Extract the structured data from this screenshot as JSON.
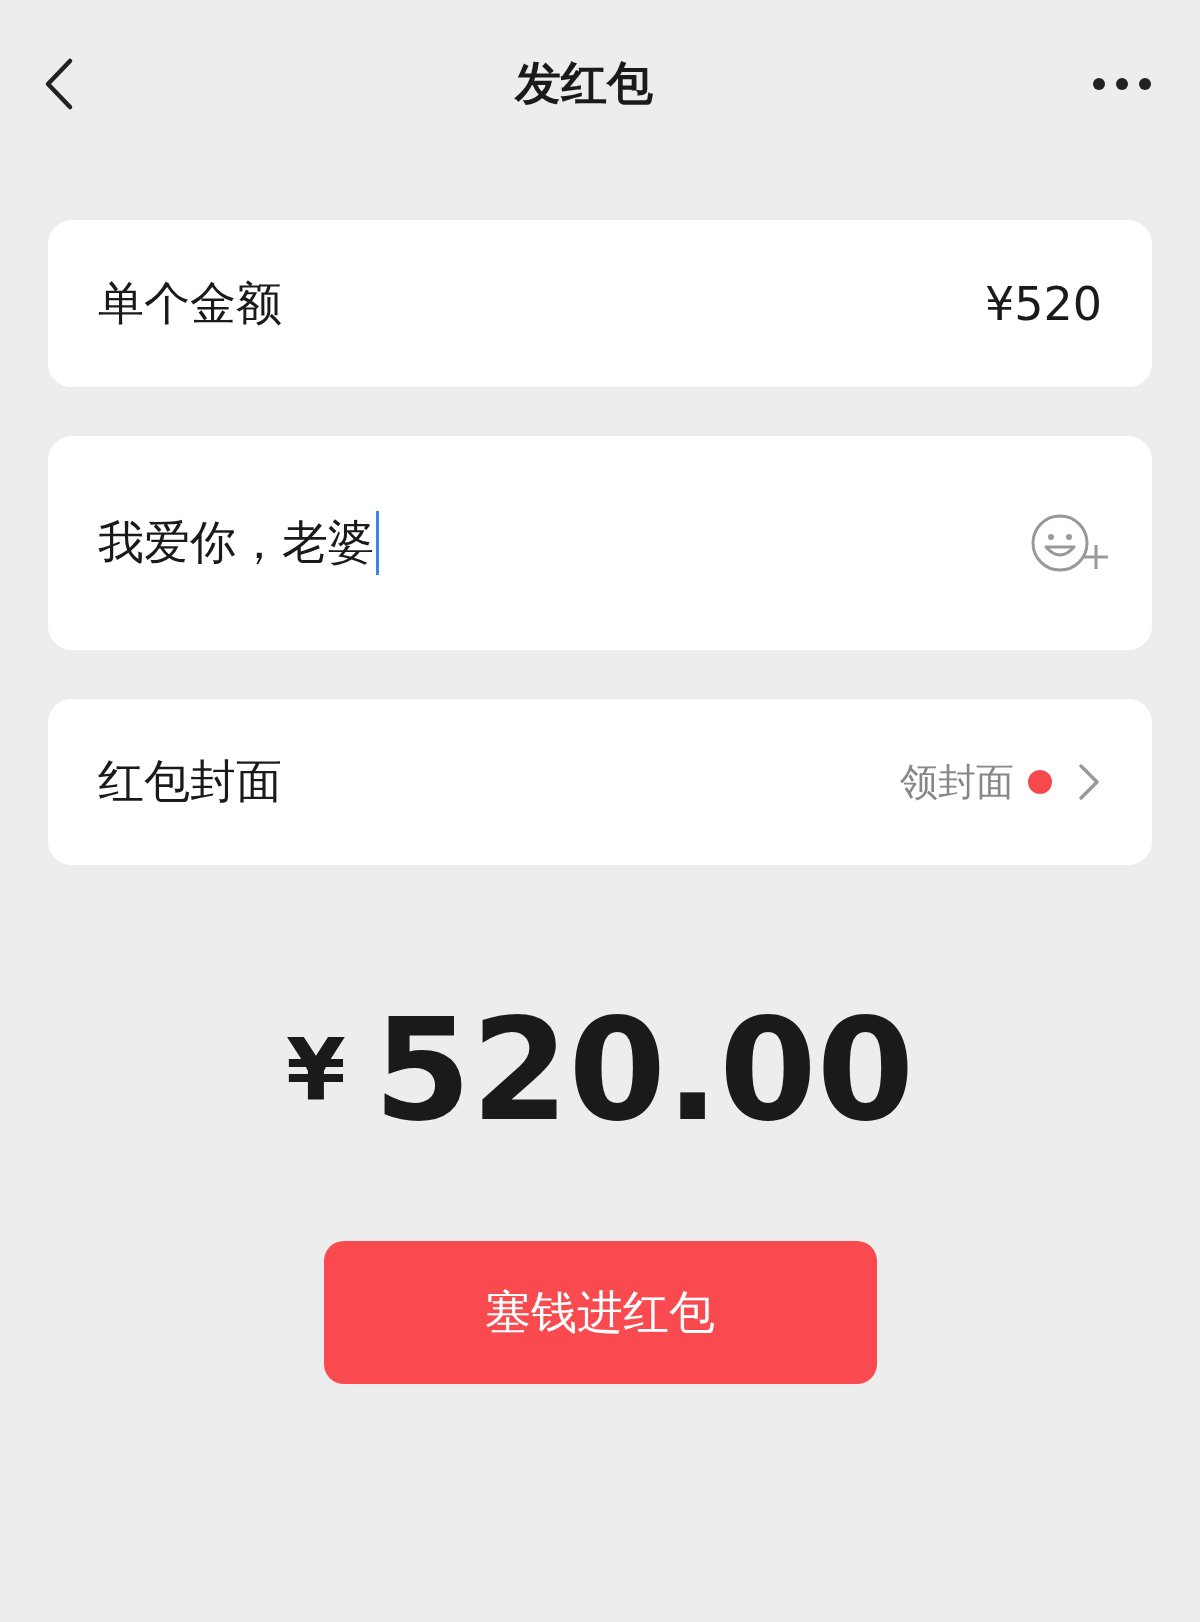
{
  "header": {
    "title": "发红包"
  },
  "amount_row": {
    "label": "单个金额",
    "value": "¥520"
  },
  "message": {
    "value": "我爱你，老婆",
    "focused": true
  },
  "cover_row": {
    "label": "红包封面",
    "action": "领封面",
    "new_badge": true
  },
  "total": {
    "currency": "¥",
    "amount": "520.00"
  },
  "submit_button": {
    "label": "塞钱进红包"
  }
}
